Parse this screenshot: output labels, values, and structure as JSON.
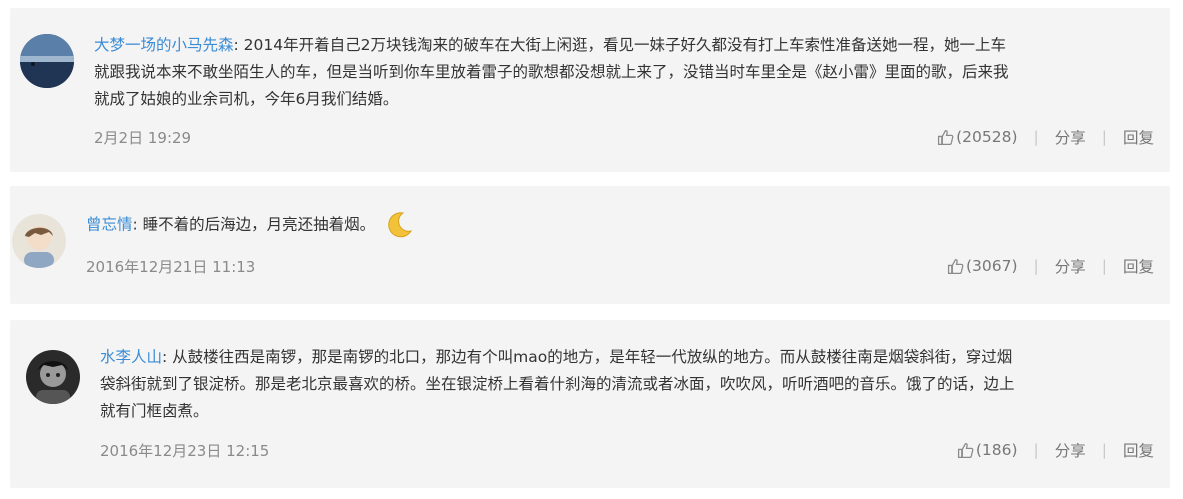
{
  "comments": [
    {
      "user": "大梦一场的小马先森",
      "text_lines": [
        ": 2014年开着自己2万块钱淘来的破车在大街上闲逛，看见一妹子好久都没有打上车索性准备送她一程，她一上车",
        "就跟我说本来不敢坐陌生人的车，但是当听到你车里放着雷子的歌想都没想就上来了，没错当时车里全是《赵小雷》里面的歌，后来我",
        "就成了姑娘的业余司机，今年6月我们结婚。"
      ],
      "date": "2月2日 19:29",
      "likes": "(20528)",
      "share": "分享",
      "reply": "回复"
    },
    {
      "user": "曾忘情",
      "text_lines": [
        ": 睡不着的后海边，月亮还抽着烟。"
      ],
      "emoji": "crescent-moon",
      "date": "2016年12月21日 11:13",
      "likes": "(3067)",
      "share": "分享",
      "reply": "回复"
    },
    {
      "user": "水李人山",
      "text_lines": [
        ": 从鼓楼往西是南锣，那是南锣的北口，那边有个叫mao的地方，是年轻一代放纵的地方。而从鼓楼往南是烟袋斜街，穿过烟",
        "袋斜街就到了银淀桥。那是老北京最喜欢的桥。坐在银淀桥上看着什刹海的清流或者冰面，吹吹风，听听酒吧的音乐。饿了的话，边上",
        "就有门框卤煮。"
      ],
      "date": "2016年12月23日 12:15",
      "likes": "(186)",
      "share": "分享",
      "reply": "回复"
    }
  ],
  "colors": {
    "username": "#3b8cd6",
    "card_bg": "#f4f4f4",
    "meta": "#8a8a8a"
  }
}
